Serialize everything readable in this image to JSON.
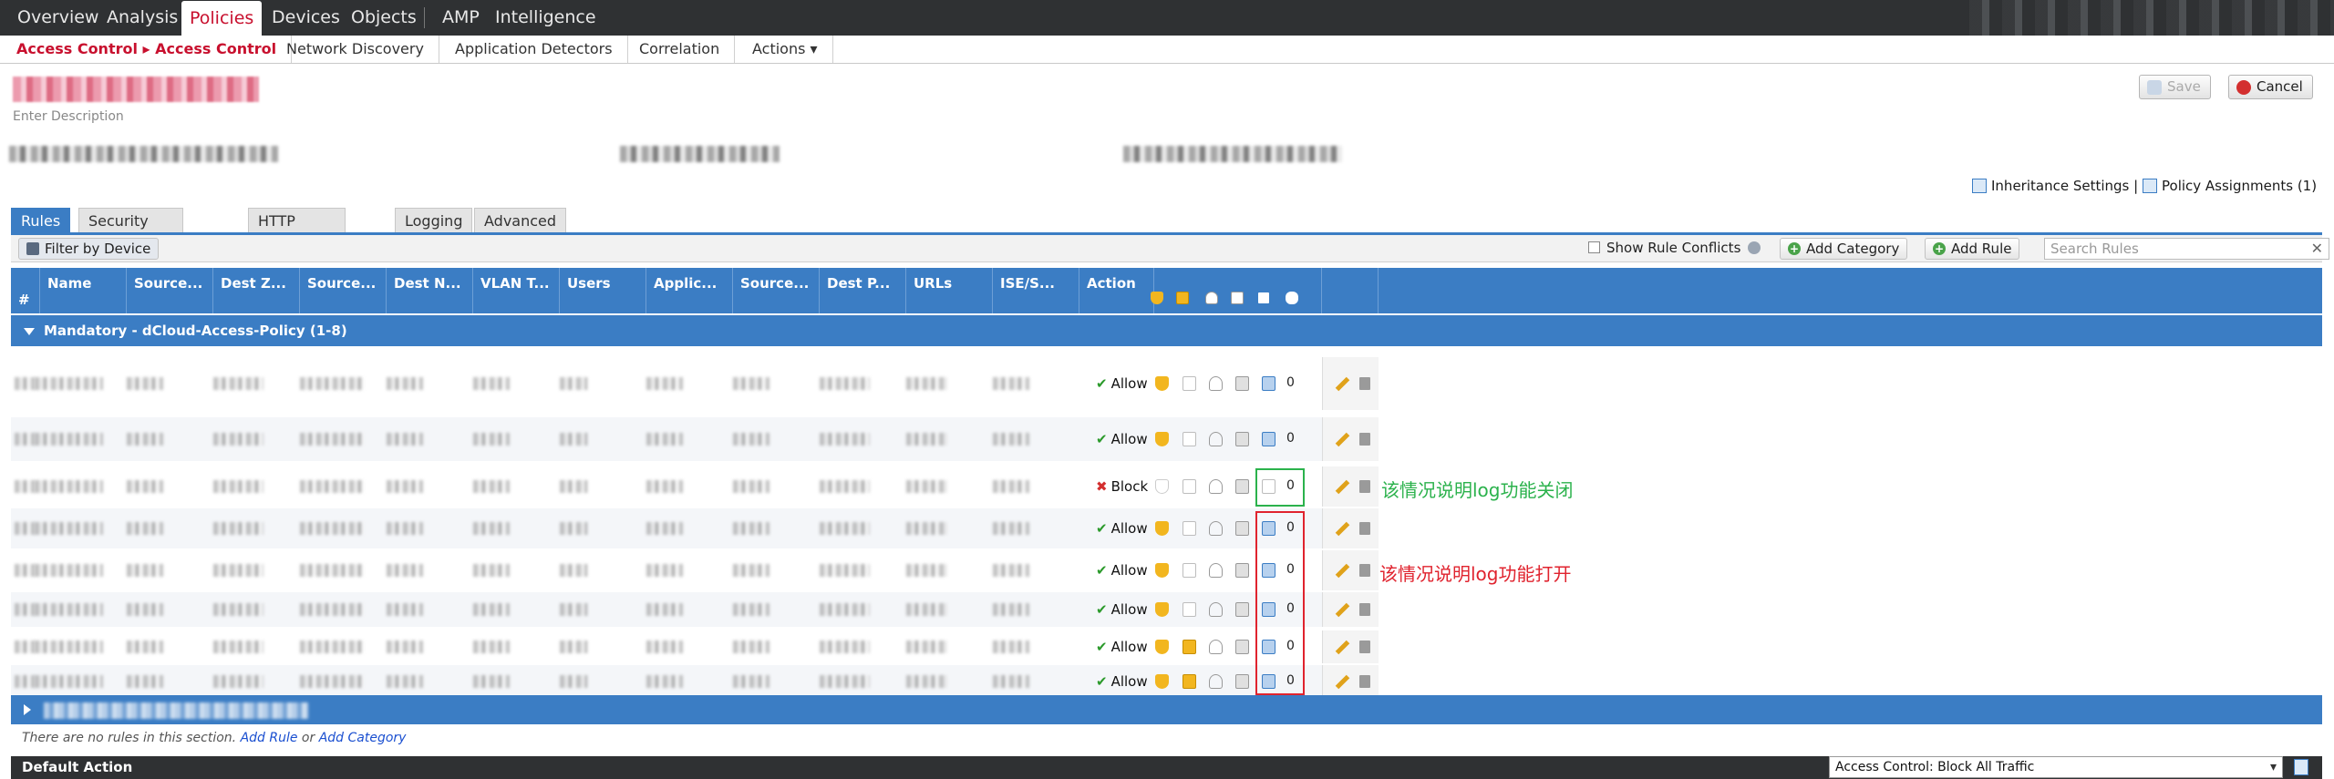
{
  "topnav": {
    "items": [
      "Overview",
      "Analysis",
      "Policies",
      "Devices",
      "Objects",
      "AMP",
      "Intelligence"
    ],
    "active": "Policies"
  },
  "subnav": {
    "breadcrumb_parent": "Access Control",
    "breadcrumb_arrow": "▸",
    "breadcrumb_current": "Access Control",
    "items": [
      "Network Discovery",
      "Application Detectors",
      "Correlation",
      "Actions ▾"
    ]
  },
  "policy": {
    "description_placeholder": "Enter Description"
  },
  "header_buttons": {
    "save": "Save",
    "cancel": "Cancel"
  },
  "links": {
    "inheritance": "Inheritance Settings",
    "separator": "|",
    "assignments": "Policy Assignments (1)"
  },
  "tabs": [
    "Rules",
    "Security Intelligence",
    "HTTP Responses",
    "Logging",
    "Advanced"
  ],
  "toolbar": {
    "filter": "Filter by Device",
    "show_conflicts": "Show Rule Conflicts",
    "add_category": "Add Category",
    "add_rule": "Add Rule",
    "search_placeholder": "Search Rules"
  },
  "columns": [
    "#",
    "Name",
    "Source...",
    "Dest Z...",
    "Source...",
    "Dest N...",
    "VLAN T...",
    "Users",
    "Applic...",
    "Source...",
    "Dest P...",
    "URLs",
    "ISE/S...",
    "Action"
  ],
  "section_mandatory": "Mandatory - dCloud-Access-Policy (1-8)",
  "rules": [
    {
      "action": "Allow",
      "count": "0",
      "log": true
    },
    {
      "action": "Allow",
      "count": "0",
      "log": true
    },
    {
      "action": "Block",
      "count": "0",
      "log": false
    },
    {
      "action": "Allow",
      "count": "0",
      "log": true
    },
    {
      "action": "Allow",
      "count": "0",
      "log": true
    },
    {
      "action": "Allow",
      "count": "0",
      "log": true
    },
    {
      "action": "Allow",
      "count": "0",
      "log": true
    },
    {
      "action": "Allow",
      "count": "0",
      "log": true
    }
  ],
  "annotations": {
    "log_off": "该情况说明log功能关闭",
    "log_on": "该情况说明log功能打开",
    "log_off_color": "#2bb24c",
    "log_on_color": "#e0232e"
  },
  "empty_section": {
    "text": "There are no rules in this section.",
    "add_rule": "Add Rule",
    "or": "or",
    "add_category": "Add Category"
  },
  "default_action": {
    "label": "Default Action",
    "value": "Access Control: Block All Traffic"
  },
  "colors": {
    "accent": "#3b7dc4",
    "brand_red": "#c8102e",
    "nav_bg": "#2f3133"
  }
}
